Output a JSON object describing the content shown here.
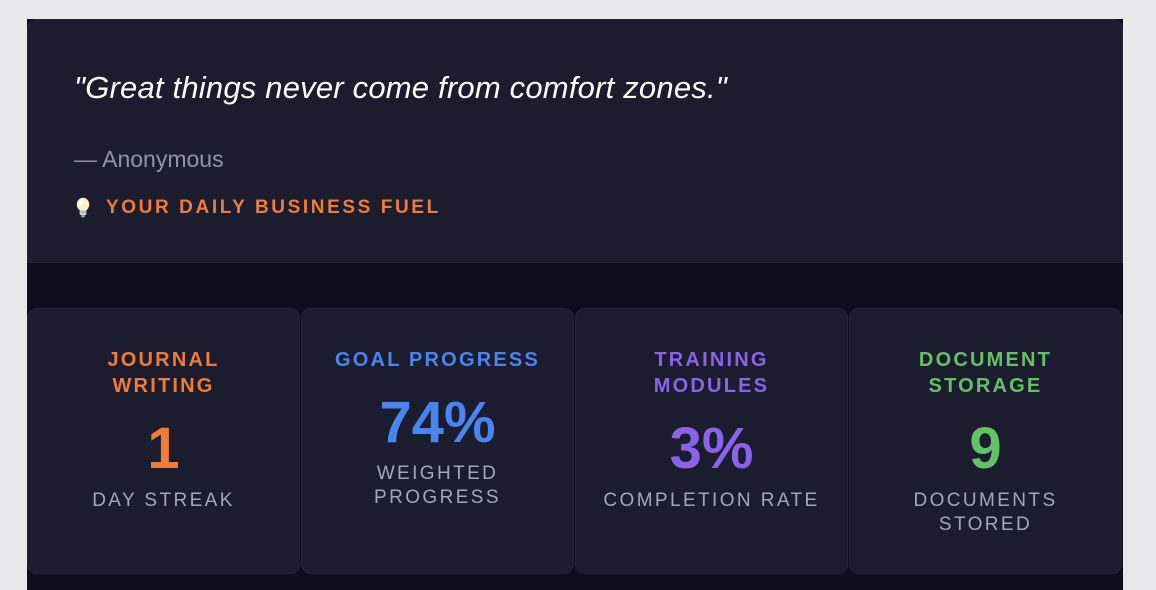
{
  "quote": {
    "text": "\"Great things never come from comfort zones.\"",
    "author": "— Anonymous",
    "tagline": "YOUR DAILY BUSINESS FUEL",
    "tagline_icon": "lightbulb-icon"
  },
  "stats": [
    {
      "title_line1": "JOURNAL",
      "title_line2": "WRITING",
      "value": "1",
      "sub_line1": "DAY STREAK",
      "sub_line2": "",
      "color": "#f07c35"
    },
    {
      "title_line1": "GOAL PROGRESS",
      "title_line2": "",
      "value": "74%",
      "sub_line1": "WEIGHTED",
      "sub_line2": "PROGRESS",
      "color": "#4a84f0"
    },
    {
      "title_line1": "TRAINING",
      "title_line2": "MODULES",
      "value": "3%",
      "sub_line1": "COMPLETION RATE",
      "sub_line2": "",
      "color": "#8a63ea"
    },
    {
      "title_line1": "DOCUMENT",
      "title_line2": "STORAGE",
      "value": "9",
      "sub_line1": "DOCUMENTS",
      "sub_line2": "STORED",
      "color": "#62c266"
    }
  ],
  "colors": {
    "accent_orange": "#f07c35",
    "card_bg": "#1b1d2e",
    "page_bg": "#0c0d1d"
  }
}
